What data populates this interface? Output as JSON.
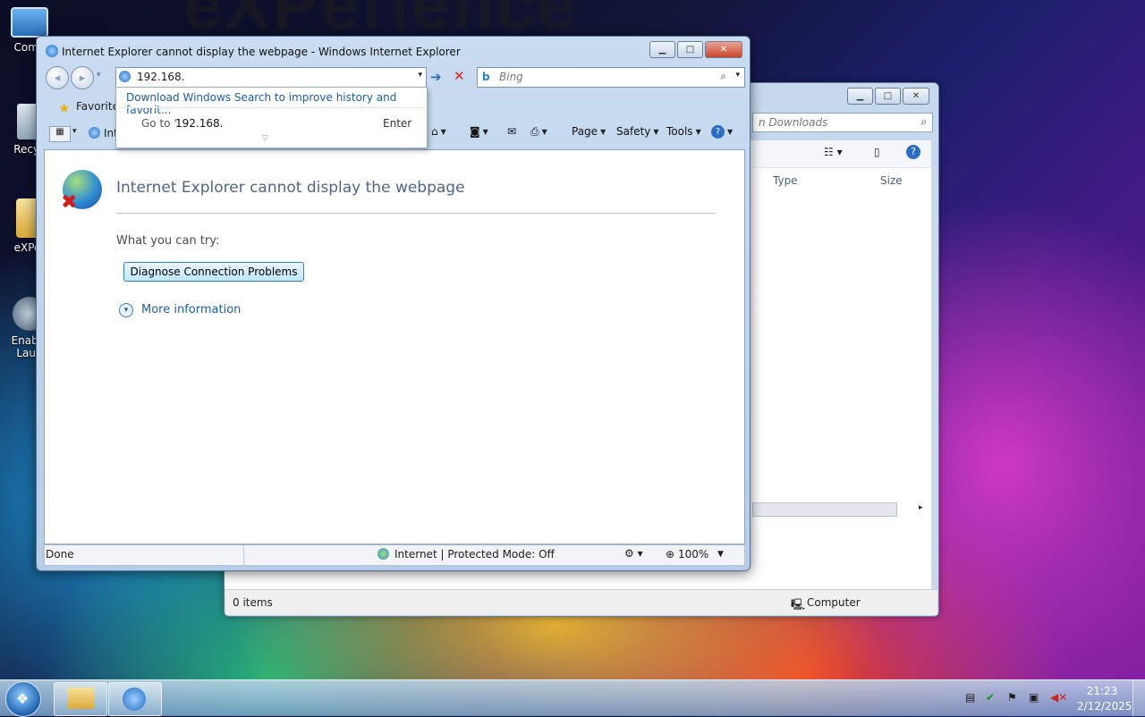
{
  "desktop": {
    "watermark": "eXPerience",
    "icons": [
      {
        "label": "Comp"
      },
      {
        "label": "Recyc"
      },
      {
        "label": "eXPer"
      },
      {
        "label": "Enable",
        "label2": "Laun"
      }
    ]
  },
  "explorer": {
    "search_placeholder": "n Downloads",
    "columns": [
      "Type",
      "Size"
    ],
    "status_items": "0 items",
    "status_location": "Computer"
  },
  "ie": {
    "window_title": "Internet Explorer cannot display the webpage - Windows Internet Explorer",
    "address_value": "192.168.",
    "search_placeholder": "Bing",
    "autocomplete": {
      "download_link": "Download Windows Search to improve history and favorit...",
      "goto_prefix": "Go to '",
      "goto_value": "192.168.",
      "goto_suffix": "'",
      "goto_key": "Enter"
    },
    "favorites_label": "Favorite",
    "tab_label": "Int",
    "toolbar": {
      "page": "Page",
      "safety": "Safety",
      "tools": "Tools"
    },
    "error": {
      "heading": "Internet Explorer cannot display the webpage",
      "try_label": "What you can try:",
      "diagnose_button": "Diagnose Connection Problems",
      "more_info": "More information"
    },
    "status": {
      "left": "Done",
      "zone": "Internet | Protected Mode: Off",
      "zoom": "100%"
    }
  },
  "taskbar": {
    "time": "21:23",
    "date": "2/12/2025"
  }
}
